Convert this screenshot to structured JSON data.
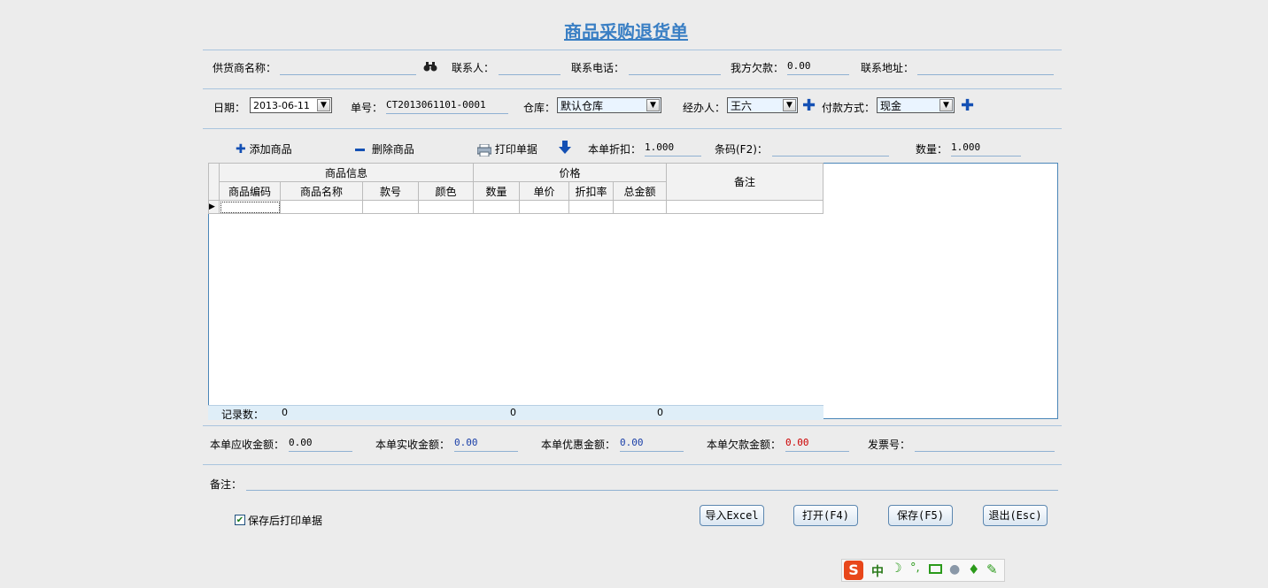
{
  "title": "商品采购退货单",
  "supplier": {
    "name_label": "供货商名称：",
    "name_value": "",
    "contact_label": "联系人：",
    "contact_value": "",
    "phone_label": "联系电话：",
    "phone_value": "",
    "debt_label": "我方欠款：",
    "debt_value": "0.00",
    "address_label": "联系地址：",
    "address_value": ""
  },
  "order": {
    "date_label": "日期：",
    "date_value": "2013-06-11",
    "no_label": "单号：",
    "no_value": "CT2013061101-0001",
    "warehouse_label": "仓库：",
    "warehouse_value": "默认仓库",
    "handler_label": "经办人：",
    "handler_value": "王六",
    "payment_label": "付款方式：",
    "payment_value": "现金"
  },
  "toolbar": {
    "add": "添加商品",
    "delete": "删除商品",
    "print": "打印单据",
    "discount_label": "本单折扣：",
    "discount_value": "1.000",
    "barcode_label": "条码(F2)：",
    "barcode_value": "",
    "qty_label": "数量：",
    "qty_value": "1.000"
  },
  "grid": {
    "group_goods": "商品信息",
    "group_price": "价格",
    "remark": "备注",
    "columns": [
      "商品编码",
      "商品名称",
      "款号",
      "颜色",
      "数量",
      "单价",
      "折扣率",
      "总金额"
    ],
    "footer_label": "记录数：",
    "footer_count": "0",
    "footer_qty": "0",
    "footer_total": "0"
  },
  "summary": {
    "receivable_label": "本单应收金额：",
    "receivable_value": "0.00",
    "received_label": "本单实收金额：",
    "received_value": "0.00",
    "discount_label": "本单优惠金额：",
    "discount_value": "0.00",
    "debt_label": "本单欠款金额：",
    "debt_value": "0.00",
    "invoice_label": "发票号：",
    "invoice_value": ""
  },
  "notes": {
    "label": "备注：",
    "value": ""
  },
  "print_after_save": {
    "label": "保存后打印单据",
    "checked": true
  },
  "buttons": {
    "import_excel": "导入Excel",
    "open": "打开(F4)",
    "save": "保存(F5)",
    "exit": "退出(Esc)"
  },
  "ime": {
    "lang": "中"
  },
  "colors": {
    "accent": "#3a7fc4",
    "blue_value": "#1a3fa8",
    "red_value": "#cc0000"
  }
}
